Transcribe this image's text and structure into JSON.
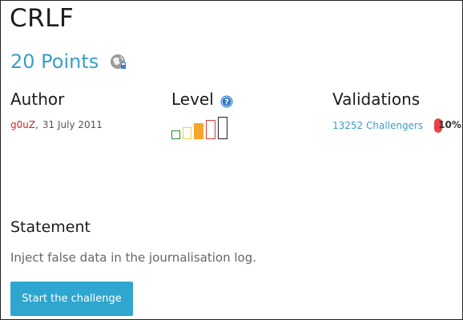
{
  "challenge": {
    "title": "CRLF",
    "points": "20 Points",
    "icon": "globe-icon"
  },
  "author": {
    "header": "Author",
    "name": "g0uZ",
    "separator": ",",
    "date": "31 July 2011"
  },
  "level": {
    "header": "Level",
    "help_icon": "help-icon",
    "bars_total": 5,
    "bars_active": 3,
    "colors": [
      "#2e8b2e",
      "#e8d23a",
      "#f5a62a",
      "#d33a3a",
      "#222222"
    ]
  },
  "validations": {
    "header": "Validations",
    "challengers": "13252 Challengers",
    "percent": "10%",
    "percent_color": "#e84444"
  },
  "statement": {
    "header": "Statement",
    "text": "Inject false data in the journalisation log."
  },
  "actions": {
    "start_label": "Start the challenge",
    "accent": "#2ea6cf"
  }
}
